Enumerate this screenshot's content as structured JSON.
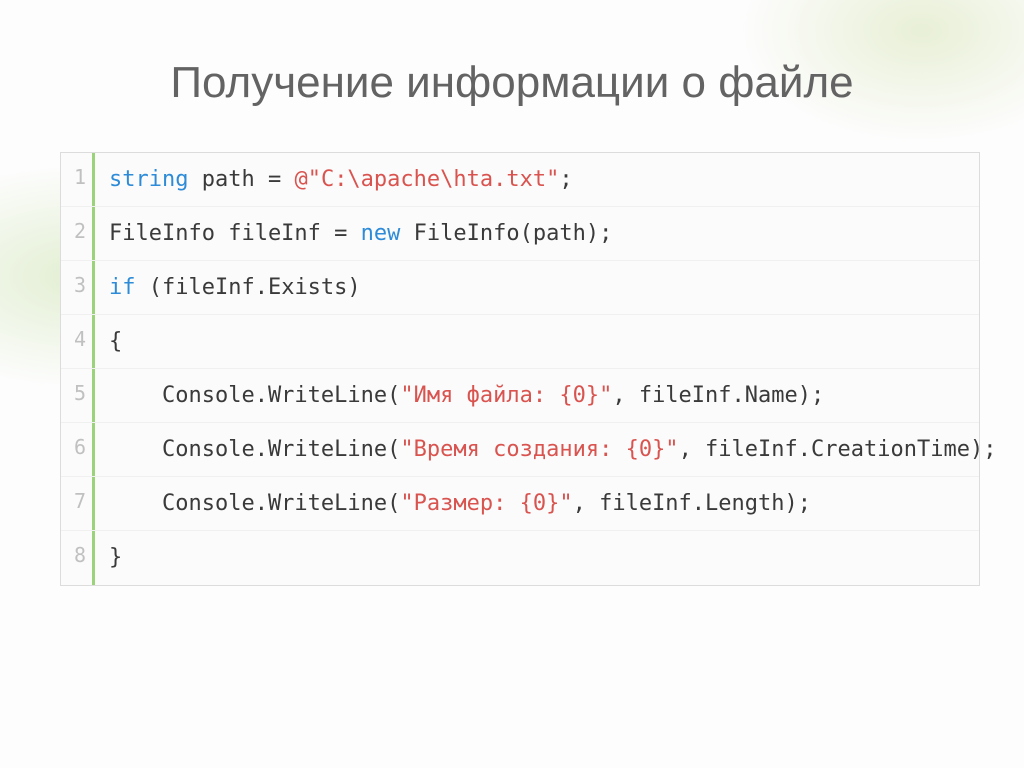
{
  "title": "Получение информации о файле",
  "code": {
    "lines": [
      {
        "num": "1",
        "tokens": [
          {
            "cls": "kw",
            "t": "string"
          },
          {
            "cls": "plain",
            "t": " path = "
          },
          {
            "cls": "str",
            "t": "@\"C:\\apache\\hta.txt\""
          },
          {
            "cls": "plain",
            "t": ";"
          }
        ]
      },
      {
        "num": "2",
        "tokens": [
          {
            "cls": "plain",
            "t": "FileInfo fileInf = "
          },
          {
            "cls": "kw",
            "t": "new"
          },
          {
            "cls": "plain",
            "t": " FileInfo(path);"
          }
        ]
      },
      {
        "num": "3",
        "tokens": [
          {
            "cls": "kw",
            "t": "if"
          },
          {
            "cls": "plain",
            "t": " (fileInf.Exists)"
          }
        ]
      },
      {
        "num": "4",
        "tokens": [
          {
            "cls": "plain",
            "t": "{"
          }
        ]
      },
      {
        "num": "5",
        "tokens": [
          {
            "cls": "plain",
            "t": "    Console.WriteLine("
          },
          {
            "cls": "str",
            "t": "\"Имя файла: {0}\""
          },
          {
            "cls": "plain",
            "t": ", fileInf.Name);"
          }
        ]
      },
      {
        "num": "6",
        "tokens": [
          {
            "cls": "plain",
            "t": "    Console.WriteLine("
          },
          {
            "cls": "str",
            "t": "\"Время создания: {0}\""
          },
          {
            "cls": "plain",
            "t": ", fileInf.CreationTime);"
          }
        ]
      },
      {
        "num": "7",
        "tokens": [
          {
            "cls": "plain",
            "t": "    Console.WriteLine("
          },
          {
            "cls": "str",
            "t": "\"Размер: {0}\""
          },
          {
            "cls": "plain",
            "t": ", fileInf.Length);"
          }
        ]
      },
      {
        "num": "8",
        "tokens": [
          {
            "cls": "plain",
            "t": "}"
          }
        ]
      }
    ]
  }
}
